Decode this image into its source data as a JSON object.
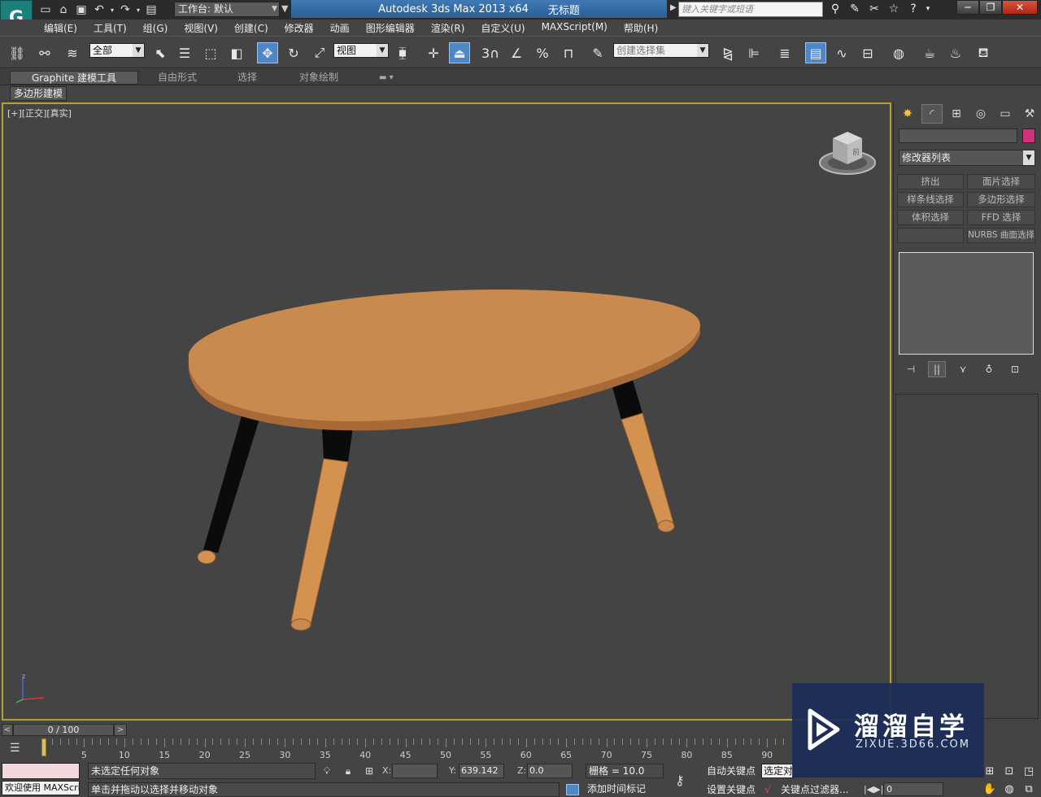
{
  "titlebar": {
    "workspace": "工作台: 默认",
    "app_title": "Autodesk 3ds Max  2013 x64",
    "doc_title": "无标题",
    "search_placeholder": "键入关键字或短语"
  },
  "menu": {
    "items": [
      "编辑(E)",
      "工具(T)",
      "组(G)",
      "视图(V)",
      "创建(C)",
      "修改器",
      "动画",
      "图形编辑器",
      "渲染(R)",
      "自定义(U)",
      "MAXScript(M)",
      "帮助(H)"
    ]
  },
  "toolbar": {
    "selection_filter": "全部",
    "ref_coord": "视图",
    "named_selection": "创建选择集",
    "snap_label": "3"
  },
  "ribbon": {
    "tabs": [
      "Graphite 建模工具",
      "自由形式",
      "选择",
      "对象绘制"
    ],
    "panel_label": "多边形建模"
  },
  "viewport": {
    "label": "[+][正交][真实]",
    "viewcube_label": "前",
    "axis_z": "z",
    "table_color": "#c98a4f",
    "leg_color": "#d4914f"
  },
  "command_panel": {
    "modifier_list": "修改器列表",
    "object_color": "#d0337c",
    "buttons": [
      "挤出",
      "面片选择",
      "样条线选择",
      "多边形选择",
      "体积选择",
      "FFD 选择",
      "",
      "NURBS 曲面选择"
    ]
  },
  "timeslider": {
    "frame_display": "0 / 100",
    "ticks": [
      "0",
      "5",
      "10",
      "15",
      "20",
      "25",
      "30",
      "35",
      "40",
      "45",
      "50",
      "55",
      "60",
      "65",
      "70",
      "75",
      "80",
      "85",
      "90"
    ]
  },
  "status": {
    "maxscript": "欢迎使用 MAXScri",
    "selection_msg": "未选定任何对象",
    "prompt": "单击并拖动以选择并移动对象",
    "x_label": "X:",
    "x_value": "",
    "y_label": "Y:",
    "y_value": "639.142",
    "z_label": "Z:",
    "z_value": "0.0",
    "grid": "栅格 = 10.0",
    "add_time_tag": "添加时间标记",
    "auto_key": "自动关键点",
    "set_key": "设置关键点",
    "selected_set": "选定对",
    "key_filters": "关键点过滤器...",
    "current_frame": "0"
  },
  "watermark": {
    "title": "溜溜自学",
    "url": "ZIXUE.3D66.COM"
  }
}
